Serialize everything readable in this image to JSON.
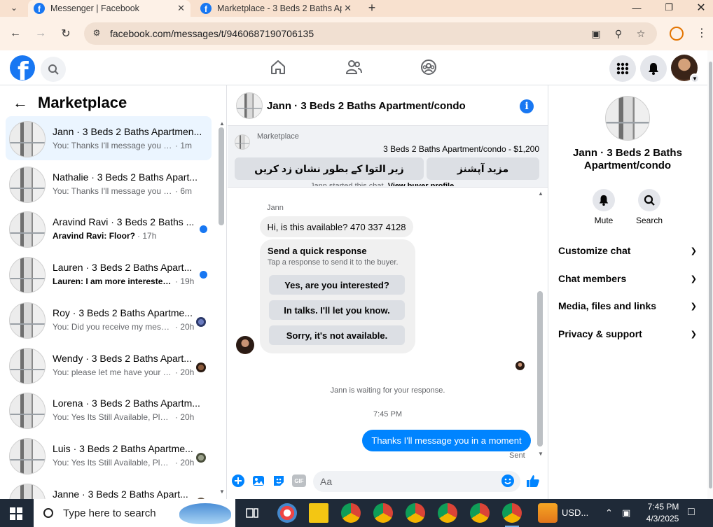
{
  "browser": {
    "tabs": [
      {
        "title": "Messenger | Facebook",
        "active": true
      },
      {
        "title": "Marketplace - 3 Beds 2 Baths Ap",
        "active": false
      }
    ],
    "url": "facebook.com/messages/t/9460687190706135"
  },
  "fb": {
    "logo": "f"
  },
  "sidebar": {
    "title": "Marketplace",
    "conversations": [
      {
        "name": "Jann · 3 Beds 2 Baths Apartmen...",
        "preview": "You: Thanks I'll message you in a ...",
        "time": "· 1m",
        "unread": false,
        "active": true,
        "indicator": "none"
      },
      {
        "name": "Nathalie · 3 Beds 2 Baths Apart...",
        "preview": "You: Thanks I'll message you in a ...",
        "time": "· 6m",
        "unread": false,
        "active": false,
        "indicator": "none"
      },
      {
        "name": "Aravind Ravi · 3 Beds 2 Baths ...",
        "preview": "Aravind Ravi: Floor?",
        "time": "· 17h",
        "unread": true,
        "active": false,
        "indicator": "dot"
      },
      {
        "name": "Lauren · 3 Beds 2 Baths Apart...",
        "preview": "Lauren: I am more interested i...",
        "time": "· 19h",
        "unread": true,
        "active": false,
        "indicator": "dot"
      },
      {
        "name": "Roy · 3 Beds 2 Baths Apartme...",
        "preview": "You: Did you receive my messa...",
        "time": "· 20h",
        "unread": false,
        "active": false,
        "indicator": "seen"
      },
      {
        "name": "Wendy · 3 Beds 2 Baths Apart...",
        "preview": "You: please let me have your c...",
        "time": "· 20h",
        "unread": false,
        "active": false,
        "indicator": "seen"
      },
      {
        "name": "Lorena · 3 Beds 2 Baths Apartm...",
        "preview": "You: Yes Its Still Available, Please S...",
        "time": "· 20h",
        "unread": false,
        "active": false,
        "indicator": "none"
      },
      {
        "name": "Luis · 3 Beds 2 Baths Apartme...",
        "preview": "You: Yes Its Still Available, Pleas...",
        "time": "· 20h",
        "unread": false,
        "active": false,
        "indicator": "seen"
      },
      {
        "name": "Janne · 3 Beds 2 Baths Apart...",
        "preview": "",
        "time": "",
        "unread": false,
        "active": false,
        "indicator": "seen"
      }
    ]
  },
  "chat": {
    "title": "Jann · 3 Beds 2 Baths Apartment/condo",
    "listing_label": "Marketplace",
    "listing": "3 Beds 2 Baths Apartment/condo - $1,200",
    "mark_pending_button": "زیر التوا کے بطور نشان زد کریں",
    "more_actions_button": "مزید آپشنز",
    "started_text": "Jann started this chat.",
    "view_buyer_link": "View buyer profile",
    "sender_name": "Jann",
    "incoming_message": "Hi, is this available? 470 337 4128",
    "quick_title": "Send a quick response",
    "quick_subtitle": "Tap a response to send it to the buyer.",
    "quick_replies": [
      "Yes, are you interested?",
      "In talks. I'll let you know.",
      "Sorry, it's not available."
    ],
    "waiting_text": "Jann is waiting for your response.",
    "timestamp": "7:45 PM",
    "outgoing_message": "Thanks I'll message you in a moment",
    "sent_label": "Sent",
    "composer_placeholder": "Aa",
    "gif_label": "GIF"
  },
  "rpanel": {
    "title": "Jann · 3 Beds 2 Baths Apartment/condo",
    "mute_label": "Mute",
    "search_label": "Search",
    "sections": [
      "Customize chat",
      "Chat members",
      "Media, files and links",
      "Privacy & support"
    ]
  },
  "taskbar": {
    "search_placeholder": "Type here to search",
    "ticker": "USD...",
    "time": "7:45 PM",
    "date": "4/3/2025"
  },
  "colors": {
    "brand": "#1877f2",
    "outgoing_bubble": "#0084ff",
    "tab_bar": "#f8e1cf",
    "taskbar": "#1f2a38"
  },
  "icons": [
    "menu-chevron-icon",
    "close-icon",
    "plus-icon",
    "back-arrow-icon",
    "forward-arrow-icon",
    "reload-icon",
    "site-info-icon",
    "install-icon",
    "zoom-icon",
    "star-icon",
    "profile-icon",
    "kebab-icon",
    "home-icon",
    "friends-icon",
    "groups-icon",
    "menu-grid-icon",
    "bell-icon",
    "info-icon",
    "plus-circle-icon",
    "photo-icon",
    "sticker-icon",
    "gif-icon",
    "emoji-icon",
    "thumbs-up-icon",
    "search-icon",
    "chevron-down-icon",
    "windows-icon"
  ]
}
